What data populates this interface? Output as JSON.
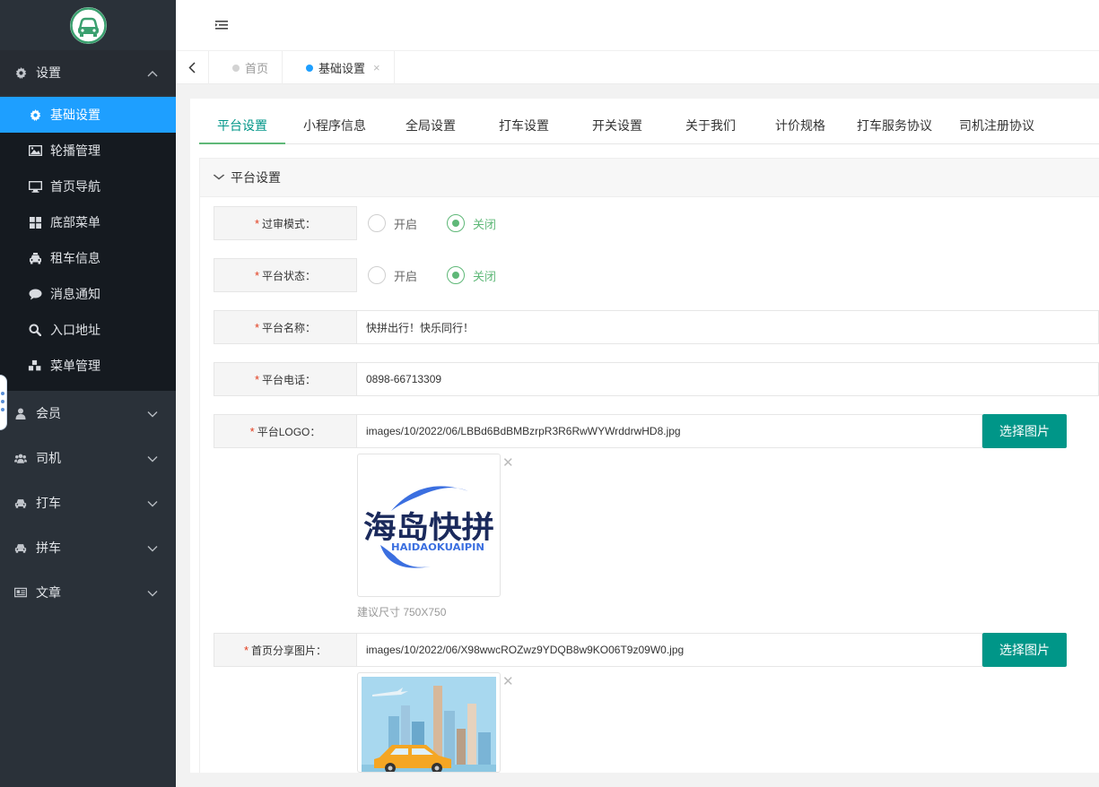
{
  "sidebar": {
    "groups": [
      {
        "label": "设置",
        "icon": "gear-icon",
        "open": true
      },
      {
        "label": "会员",
        "icon": "user-icon"
      },
      {
        "label": "司机",
        "icon": "users-icon"
      },
      {
        "label": "打车",
        "icon": "car-icon"
      },
      {
        "label": "拼车",
        "icon": "car-icon"
      },
      {
        "label": "文章",
        "icon": "newspaper-icon"
      }
    ],
    "settings_items": [
      {
        "label": "基础设置",
        "icon": "gear-icon",
        "active": true
      },
      {
        "label": "轮播管理",
        "icon": "image-icon"
      },
      {
        "label": "首页导航",
        "icon": "monitor-icon"
      },
      {
        "label": "底部菜单",
        "icon": "grid-icon"
      },
      {
        "label": "租车信息",
        "icon": "taxi-icon"
      },
      {
        "label": "消息通知",
        "icon": "chat-icon"
      },
      {
        "label": "入口地址",
        "icon": "search-icon"
      },
      {
        "label": "菜单管理",
        "icon": "cubes-icon"
      }
    ]
  },
  "tabs": {
    "home": "首页",
    "current": "基础设置",
    "close": "×"
  },
  "config_tabs": [
    "平台设置",
    "小程序信息",
    "全局设置",
    "打车设置",
    "开关设置",
    "关于我们",
    "计价规格",
    "打车服务协议",
    "司机注册协议"
  ],
  "panel": {
    "title": "平台设置"
  },
  "form": {
    "review_mode": {
      "label": "过审模式：",
      "options": [
        "开启",
        "关闭"
      ],
      "selected": "关闭"
    },
    "platform_status": {
      "label": "平台状态：",
      "options": [
        "开启",
        "关闭"
      ],
      "selected": "关闭"
    },
    "platform_name": {
      "label": "平台名称：",
      "value": "快拼出行！快乐同行！"
    },
    "platform_phone": {
      "label": "平台电话：",
      "value": "0898-66713309"
    },
    "platform_logo": {
      "label": "平台LOGO：",
      "value": "images/10/2022/06/LBBd6BdBMBzrpR3R6RwWYWrddrwHD8.jpg",
      "button": "选择图片",
      "hint": "建议尺寸 750X750"
    },
    "share_image": {
      "label": "首页分享图片：",
      "value": "images/10/2022/06/X98wwcROZwz9YDQB8w9KO06T9z09W0.jpg",
      "button": "选择图片"
    }
  },
  "logo_image": {
    "cn_text": "海岛快拼",
    "en_text": "HAIDAOKUAIPIN",
    "colors": {
      "navy": "#1b2a5c",
      "blue": "#3b6fe0"
    }
  },
  "colors": {
    "sidebar_bg": "#2a3139",
    "sidebar_active": "#1e9fff",
    "primary_green": "#009688",
    "radio_green": "#5fb878",
    "required_red": "#e23b1c"
  }
}
